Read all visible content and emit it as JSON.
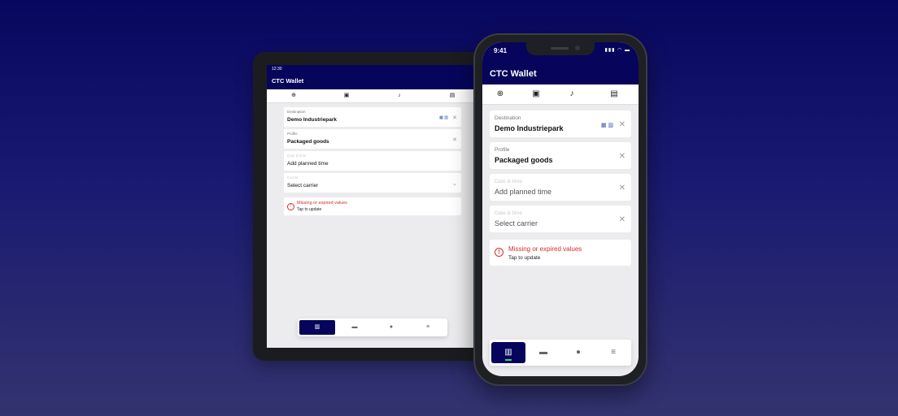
{
  "tablet": {
    "status_time": "12:30",
    "app_title": "CTC Wallet",
    "fields": [
      {
        "label": "Destination",
        "value": "Demo Industriepark"
      },
      {
        "label": "Profile",
        "value": "Packaged goods"
      },
      {
        "label": "Date & time",
        "value": "Add planned time"
      },
      {
        "label": "Carrier",
        "value": "Select carrier"
      }
    ],
    "alert": {
      "title": "Missing or expired values",
      "subtitle": "Tap to update"
    }
  },
  "phone": {
    "status_time": "9:41",
    "app_title": "CTC Wallet",
    "fields": [
      {
        "label": "Destination",
        "value": "Demo Industriepark"
      },
      {
        "label": "Profile",
        "value": "Packaged goods"
      },
      {
        "label": "Date & time",
        "value": "Add planned time"
      },
      {
        "label": "Date & time",
        "value": "Select carrier"
      }
    ],
    "alert": {
      "title": "Missing or expired values",
      "subtitle": "Tap to update"
    }
  },
  "toolbar_icons": [
    "add-circle-icon",
    "save-icon",
    "bell-icon",
    "id-card-icon"
  ],
  "nav_icons": [
    "buildings-icon",
    "truck-icon",
    "person-icon",
    "menu-icon"
  ],
  "colors": {
    "brand": "#06055b",
    "error": "#d92c2c",
    "active_indicator": "#3ad07b"
  }
}
